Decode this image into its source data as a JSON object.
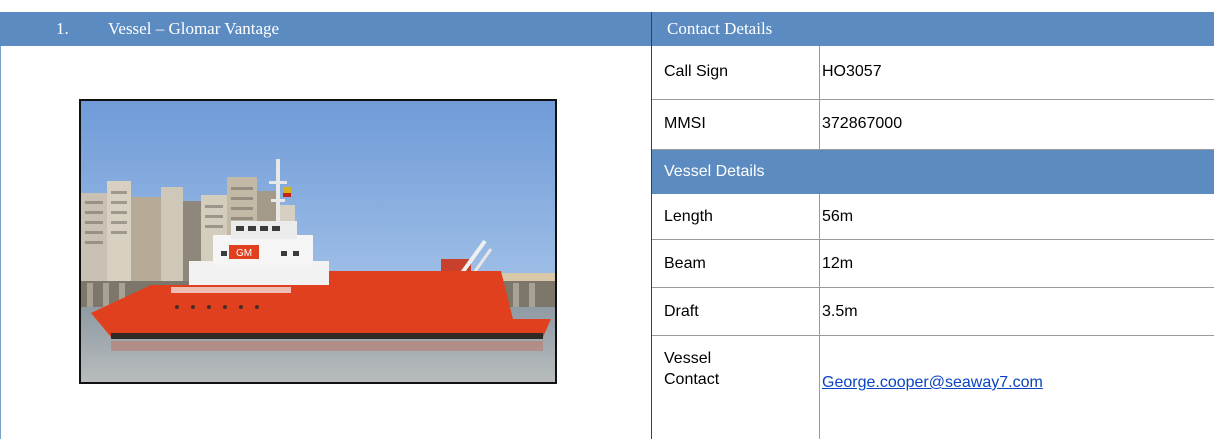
{
  "section": {
    "number": "1.",
    "title": "Vessel – Glomar Vantage"
  },
  "contact": {
    "header": "Contact Details",
    "rows": [
      {
        "label": "Call Sign",
        "value": "HO3057"
      },
      {
        "label": "MMSI",
        "value": "372867000"
      }
    ]
  },
  "vessel": {
    "header": "Vessel Details",
    "rows": [
      {
        "label": "Length",
        "value": "56m"
      },
      {
        "label": "Beam",
        "value": "12m"
      },
      {
        "label": "Draft",
        "value": "3.5m"
      }
    ],
    "contact_label_line1": "Vessel",
    "contact_label_line2": "Contact",
    "contact_email": "George.cooper@seaway7.com"
  },
  "photo": {
    "funnel_text": "GM"
  },
  "colors": {
    "header_bg": "#5b8bc0",
    "link": "#0b43c2",
    "hull": "#e0401e"
  }
}
